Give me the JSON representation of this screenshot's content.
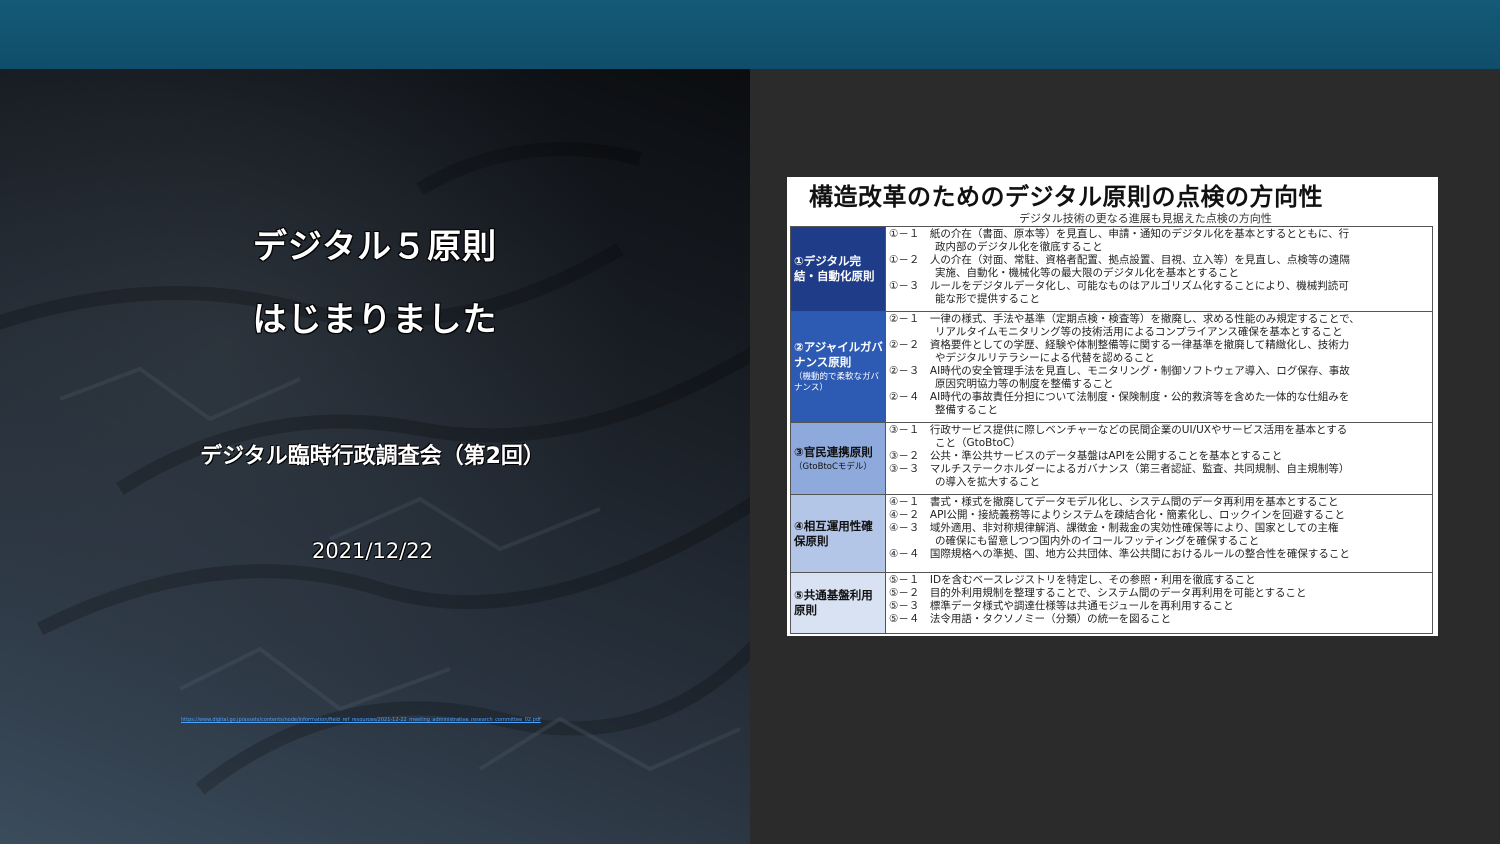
{
  "slide": {
    "title_line1": "デジタル５原則",
    "title_line2": "はじまりました",
    "subtitle": "デジタル臨時行政調査会（第2回）",
    "date": "2021/12/22",
    "source_url": "https://www.digital.go.jp/assets/contents/node/information/field_ref_resources/2021-12-22_meeting_administrative_research_committee_02.pdf"
  },
  "document": {
    "title": "構造改革のためのデジタル原則の点検の方向性",
    "subtitle": "デジタル技術の更なる進展も見据えた点検の方向性",
    "colors": {
      "row1_head": "#1f3c88",
      "row2_head": "#2d5bb3",
      "row3_head": "#8ea9db",
      "row4_head": "#b4c6e7",
      "row5_head": "#d9e2f3"
    },
    "rows": [
      {
        "heading": "①デジタル完結・自動化原則",
        "note": "",
        "items": [
          {
            "line": "①－１　紙の介在（書面、原本等）を見直し、申請・通知のデジタル化を基本とするとともに、行",
            "cont": "政内部のデジタル化を徹底すること"
          },
          {
            "line": "①－２　人の介在（対面、常駐、資格者配置、拠点設置、目視、立入等）を見直し、点検等の遠隔",
            "cont": "実施、自動化・機械化等の最大限のデジタル化を基本とすること"
          },
          {
            "line": "①－３　ルールをデジタルデータ化し、可能なものはアルゴリズム化することにより、機械判読可",
            "cont": "能な形で提供すること"
          }
        ]
      },
      {
        "heading": "②アジャイルガバナンス原則",
        "note": "（機動的で柔軟なガバナンス）",
        "items": [
          {
            "line": "②－１　一律の様式、手法や基準（定期点検・検査等）を撤廃し、求める性能のみ規定することで、",
            "cont": "リアルタイムモニタリング等の技術活用によるコンプライアンス確保を基本とすること"
          },
          {
            "line": "②－２　資格要件としての学歴、経験や体制整備等に関する一律基準を撤廃して精緻化し、技術力",
            "cont": "やデジタルリテラシーによる代替を認めること"
          },
          {
            "line": "②－３　AI時代の安全管理手法を見直し、モニタリング・制御ソフトウェア導入、ログ保存、事故",
            "cont": "原因究明協力等の制度を整備すること"
          },
          {
            "line": "②－４　AI時代の事故責任分担について法制度・保険制度・公的救済等を含めた一体的な仕組みを",
            "cont": "整備すること"
          }
        ]
      },
      {
        "heading": "③官民連携原則",
        "note": "（GtoBtoCモデル）",
        "items": [
          {
            "line": "③－１　行政サービス提供に際しベンチャーなどの民間企業のUI/UXやサービス活用を基本とする",
            "cont": "こと（GtoBtoC）"
          },
          {
            "line": "③－２　公共・準公共サービスのデータ基盤はAPIを公開することを基本とすること",
            "cont": ""
          },
          {
            "line": "③－３　マルチステークホルダーによるガバナンス（第三者認証、監査、共同規制、自主規制等）",
            "cont": "の導入を拡大すること"
          }
        ]
      },
      {
        "heading": "④相互運用性確保原則",
        "note": "",
        "items": [
          {
            "line": "④－１　書式・様式を撤廃してデータモデル化し、システム間のデータ再利用を基本とすること",
            "cont": ""
          },
          {
            "line": "④－２　API公開・接続義務等によりシステムを疎結合化・簡素化し、ロックインを回避すること",
            "cont": ""
          },
          {
            "line": "④－３　域外適用、非対称規律解消、課徴金・制裁金の実効性確保等により、国家としての主権",
            "cont": "の確保にも留意しつつ国内外のイコールフッティングを確保すること"
          },
          {
            "line": "④－４　国際規格への準拠、国、地方公共団体、準公共間におけるルールの整合性を確保すること",
            "cont": ""
          }
        ]
      },
      {
        "heading": "⑤共通基盤利用原則",
        "note": "",
        "items": [
          {
            "line": "⑤－１　IDを含むベースレジストリを特定し、その参照・利用を徹底すること",
            "cont": ""
          },
          {
            "line": "⑤－２　目的外利用規制を整理することで、システム間のデータ再利用を可能とすること",
            "cont": ""
          },
          {
            "line": "⑤－３　標準データ様式や調達仕様等は共通モジュールを再利用すること",
            "cont": ""
          },
          {
            "line": "⑤－４　法令用語・タクソノミー（分類）の統一を図ること",
            "cont": ""
          }
        ]
      }
    ]
  }
}
